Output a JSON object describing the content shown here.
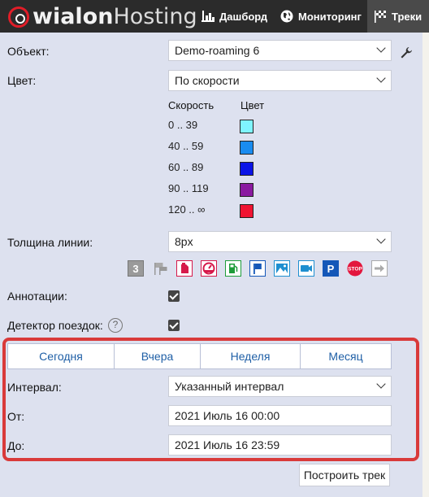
{
  "header": {
    "logo_main": "wialon",
    "logo_sub": "Hosting",
    "nav": [
      {
        "label": "Дашборд",
        "icon": "bar-chart-icon"
      },
      {
        "label": "Мониторинг",
        "icon": "globe-icon"
      },
      {
        "label": "Треки",
        "icon": "checkered-flag-icon",
        "active": true
      }
    ]
  },
  "form": {
    "object_label": "Объект:",
    "object_value": "Demo-roaming 6",
    "color_label": "Цвет:",
    "color_value": "По скорости",
    "legend": {
      "speed_header": "Скорость",
      "color_header": "Цвет",
      "rows": [
        {
          "range": "0 .. 39",
          "color": "#7ff5ff"
        },
        {
          "range": "40 .. 59",
          "color": "#1a8cf0"
        },
        {
          "range": "60 .. 89",
          "color": "#0a14e6"
        },
        {
          "range": "90 .. 119",
          "color": "#8a1aa0"
        },
        {
          "range": "120 .. ∞",
          "color": "#f01432"
        }
      ]
    },
    "line_width_label": "Толщина линии:",
    "line_width_value": "8px",
    "annotations_label": "Аннотации:",
    "trip_detector_label": "Детектор поездок:",
    "help_glyph": "?",
    "counter_icon_text": "3",
    "stop_icon_text": "STOP",
    "parking_icon_text": "P"
  },
  "interval": {
    "tabs": [
      "Сегодня",
      "Вчера",
      "Неделя",
      "Месяц"
    ],
    "interval_label": "Интервал:",
    "interval_value": "Указанный интервал",
    "from_label": "От:",
    "from_value": "2021 Июль 16 00:00",
    "to_label": "До:",
    "to_value": "2021 Июль 16 23:59"
  },
  "actions": {
    "build_track": "Построить трек"
  },
  "colors": {
    "topbar": "#2b2b2b",
    "panel": "#dde1ef",
    "accent_red": "#d93a3a",
    "tab_text": "#1f5fa6"
  }
}
